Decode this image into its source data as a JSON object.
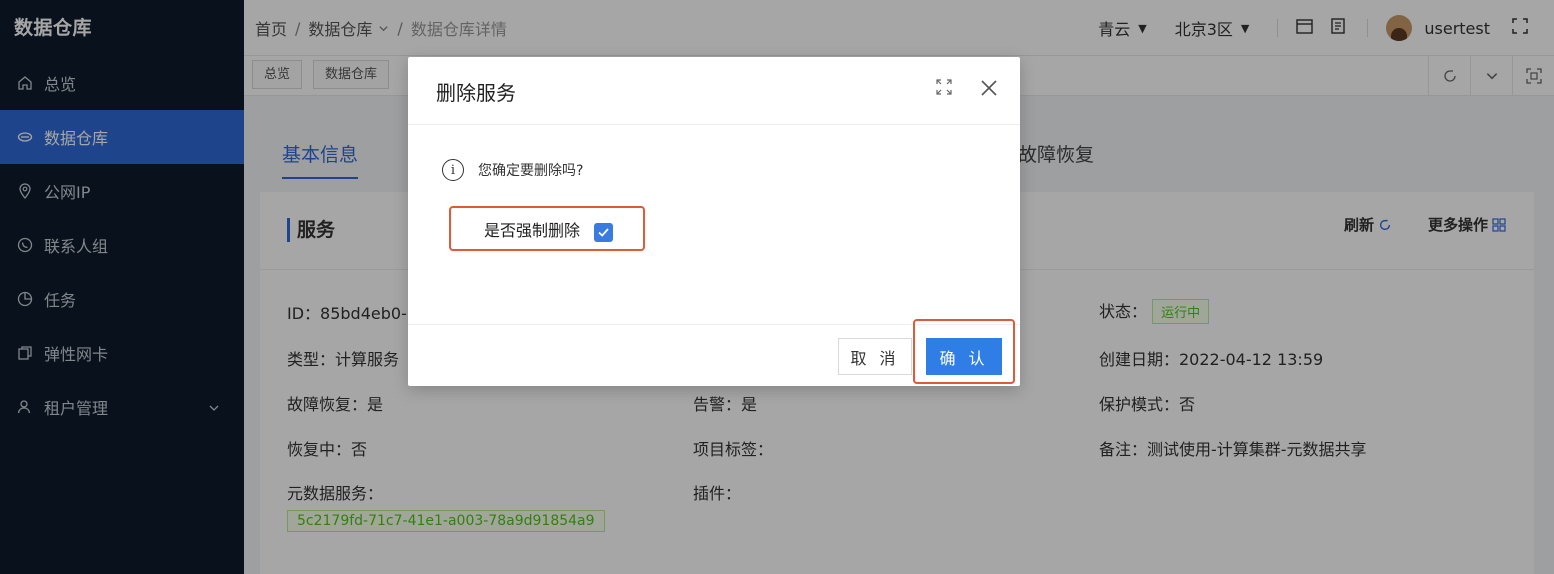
{
  "app": {
    "brand": "数据仓库"
  },
  "sidebar": {
    "items": [
      {
        "label": "总览",
        "icon": "home-icon"
      },
      {
        "label": "数据仓库",
        "icon": "cloud-icon",
        "active": true
      },
      {
        "label": "公网IP",
        "icon": "location-icon"
      },
      {
        "label": "联系人组",
        "icon": "phone-icon"
      },
      {
        "label": "任务",
        "icon": "pie-chart-icon"
      },
      {
        "label": "弹性网卡",
        "icon": "copy-icon"
      },
      {
        "label": "租户管理",
        "icon": "user-icon"
      }
    ]
  },
  "breadcrumb": {
    "home": "首页",
    "section": "数据仓库",
    "current": "数据仓库详情"
  },
  "topbar": {
    "cloud": "青云",
    "region": "北京3区",
    "username": "usertest"
  },
  "tagsbar": {
    "tags": [
      "总览",
      "数据仓库"
    ]
  },
  "tabs": {
    "basic": "基本信息",
    "recovery": "故障恢复"
  },
  "card": {
    "title": "服务",
    "refresh": "刷新",
    "more": "更多操作"
  },
  "fields": {
    "id": "ID：85bd4eb0-",
    "type": "类型：计算服务",
    "fault_recovery": "故障恢复：是",
    "recovering": "恢复中：否",
    "metadata_service": "元数据服务：",
    "metadata_uuid": "5c2179fd-71c7-41e1-a003-78a9d91854a9",
    "alarm": "告警：是",
    "project_tag": "项目标签：",
    "plugin": "插件：",
    "status_label": "状态：",
    "status_value": "运行中",
    "created": "创建日期：2022-04-12 13:59",
    "protect": "保护模式：否",
    "note": "备注：测试使用-计算集群-元数据共享"
  },
  "modal": {
    "title": "删除服务",
    "message": "您确定要删除吗?",
    "force_label": "是否强制删除",
    "force_checked": true,
    "cancel": "取 消",
    "ok": "确 认"
  },
  "colors": {
    "primary": "#2f6bd8",
    "highlight": "#e05a3a",
    "sidebar": "#0f1c2b"
  }
}
